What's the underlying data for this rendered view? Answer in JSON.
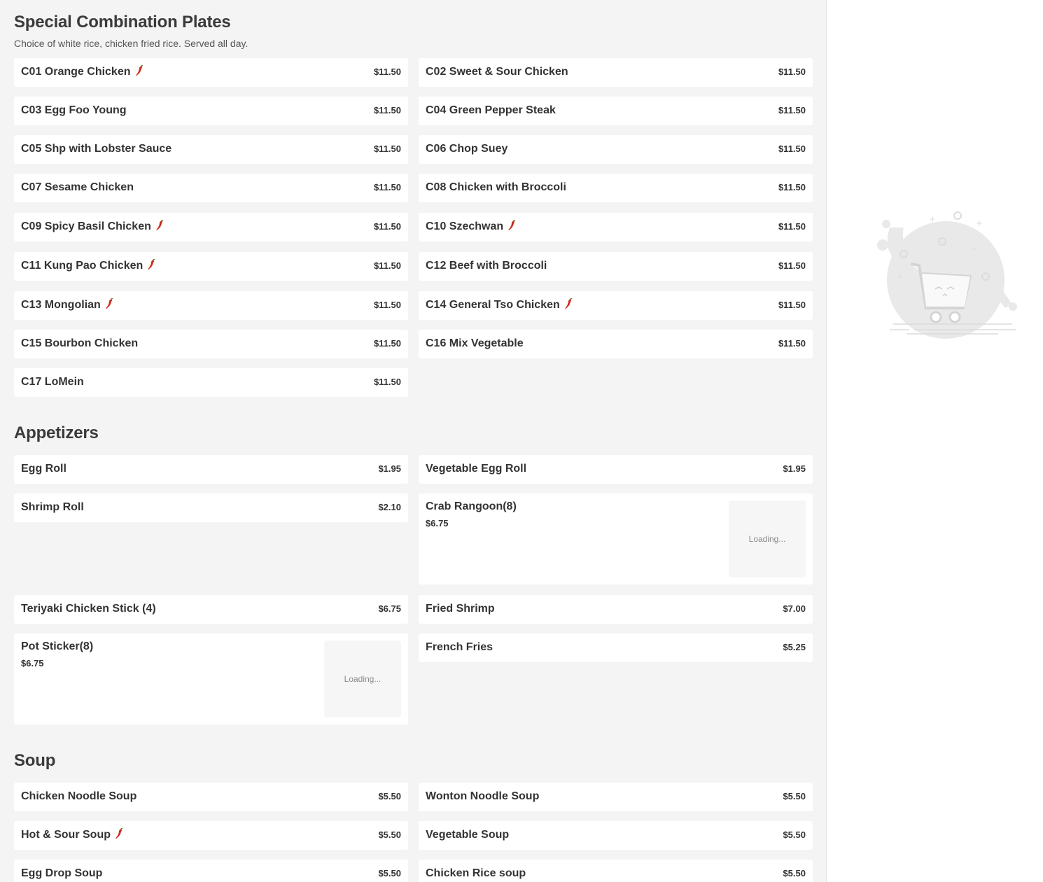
{
  "sections": [
    {
      "title": "Special Combination Plates",
      "description": "Choice of white rice, chicken fried rice. Served all day.",
      "items": [
        {
          "name": "C01 Orange Chicken",
          "price": "$11.50",
          "spicy": true
        },
        {
          "name": "C02 Sweet & Sour Chicken",
          "price": "$11.50",
          "spicy": false
        },
        {
          "name": "C03 Egg Foo Young",
          "price": "$11.50",
          "spicy": false
        },
        {
          "name": "C04 Green Pepper Steak",
          "price": "$11.50",
          "spicy": false
        },
        {
          "name": "C05 Shp with Lobster Sauce",
          "price": "$11.50",
          "spicy": false
        },
        {
          "name": "C06 Chop Suey",
          "price": "$11.50",
          "spicy": false
        },
        {
          "name": "C07 Sesame Chicken",
          "price": "$11.50",
          "spicy": false
        },
        {
          "name": "C08 Chicken with Broccoli",
          "price": "$11.50",
          "spicy": false
        },
        {
          "name": "C09 Spicy Basil Chicken",
          "price": "$11.50",
          "spicy": true
        },
        {
          "name": "C10 Szechwan",
          "price": "$11.50",
          "spicy": true
        },
        {
          "name": "C11 Kung Pao Chicken",
          "price": "$11.50",
          "spicy": true
        },
        {
          "name": "C12 Beef with Broccoli",
          "price": "$11.50",
          "spicy": false
        },
        {
          "name": "C13 Mongolian",
          "price": "$11.50",
          "spicy": true
        },
        {
          "name": "C14 General Tso Chicken",
          "price": "$11.50",
          "spicy": true
        },
        {
          "name": "C15 Bourbon Chicken",
          "price": "$11.50",
          "spicy": false
        },
        {
          "name": "C16 Mix Vegetable",
          "price": "$11.50",
          "spicy": false
        },
        {
          "name": "C17 LoMein",
          "price": "$11.50",
          "spicy": false
        }
      ]
    },
    {
      "title": "Appetizers",
      "items": [
        {
          "name": "Egg Roll",
          "price": "$1.95",
          "spicy": false
        },
        {
          "name": "Vegetable Egg Roll",
          "price": "$1.95",
          "spicy": false
        },
        {
          "name": "Shrimp Roll",
          "price": "$2.10",
          "spicy": false
        },
        {
          "name": "Crab Rangoon(8)",
          "price": "$6.75",
          "spicy": false,
          "image_text": "Loading..."
        },
        {
          "name": "Teriyaki Chicken Stick (4)",
          "price": "$6.75",
          "spicy": false
        },
        {
          "name": "Fried Shrimp",
          "price": "$7.00",
          "spicy": false
        },
        {
          "name": "Pot Sticker(8)",
          "price": "$6.75",
          "spicy": false,
          "image_text": "Loading..."
        },
        {
          "name": "French Fries",
          "price": "$5.25",
          "spicy": false
        }
      ]
    },
    {
      "title": "Soup",
      "items": [
        {
          "name": "Chicken Noodle Soup",
          "price": "$5.50",
          "spicy": false
        },
        {
          "name": "Wonton Noodle Soup",
          "price": "$5.50",
          "spicy": false
        },
        {
          "name": "Hot & Sour Soup",
          "price": "$5.50",
          "spicy": true
        },
        {
          "name": "Vegetable Soup",
          "price": "$5.50",
          "spicy": false
        },
        {
          "name": "Egg Drop Soup",
          "price": "$5.50",
          "spicy": false
        },
        {
          "name": "Chicken Rice soup",
          "price": "$5.50",
          "spicy": false
        }
      ]
    }
  ],
  "icons": {
    "spicy": "chili-pepper-icon",
    "cart": "empty-cart-illustration"
  },
  "colors": {
    "background": "#f4f4f4",
    "card": "#ffffff",
    "chili": "#d0281c",
    "text": "#333333"
  }
}
